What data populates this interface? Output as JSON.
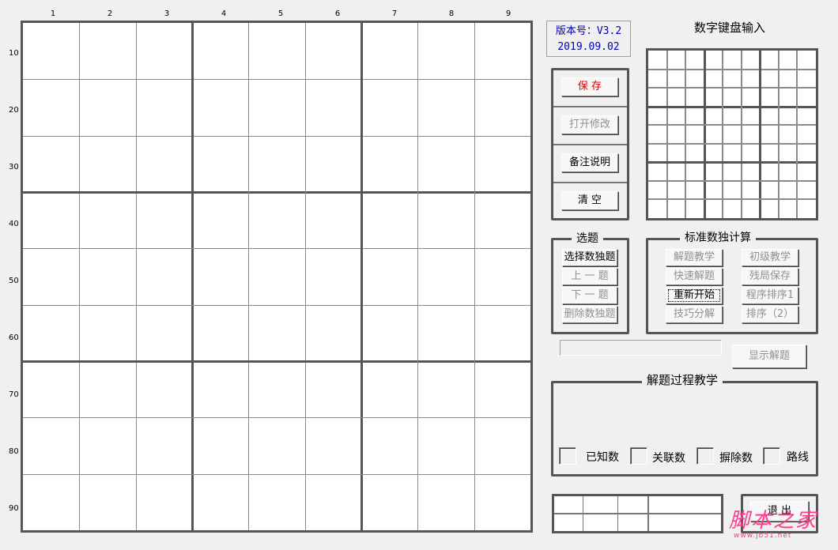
{
  "grid": {
    "col_labels": [
      "1",
      "2",
      "3",
      "4",
      "5",
      "6",
      "7",
      "8",
      "9"
    ],
    "row_labels": [
      "10",
      "20",
      "30",
      "40",
      "50",
      "60",
      "70",
      "80",
      "90"
    ]
  },
  "version": {
    "line1": "版本号：V3.2",
    "line2": "2019.09.02"
  },
  "numpad": {
    "title": "数字键盘输入"
  },
  "file_buttons": {
    "save": "保  存",
    "open_edit": "打开修改",
    "notes": "备注说明",
    "clear": "清  空"
  },
  "select_panel": {
    "title": "选题",
    "choose": "选择数独题",
    "prev": "上 一  题",
    "next": "下 一  题",
    "delete": "删除数独题"
  },
  "calc_panel": {
    "title": "标准数独计算",
    "teach_solve": "解题教学",
    "beginner_teach": "初级教学",
    "quick_solve": "快速解题",
    "save_partial": "残局保存",
    "restart": "重新开始",
    "sort1": "程序排序1",
    "technique": "技巧分解",
    "sort2": "排序（2）"
  },
  "show_solution": "显示解题",
  "process_panel": {
    "title": "解题过程教学",
    "known": "已知数",
    "related": "关联数",
    "excluded": "摒除数",
    "route": "路线"
  },
  "exit_button": "退 出",
  "watermark": {
    "main": "脚本之家",
    "sub": "www.jb51.net"
  },
  "colors": {
    "version_text": "#0000b0",
    "save_text": "#d00000",
    "border": "#555555",
    "watermark": "#ff3a8c"
  }
}
